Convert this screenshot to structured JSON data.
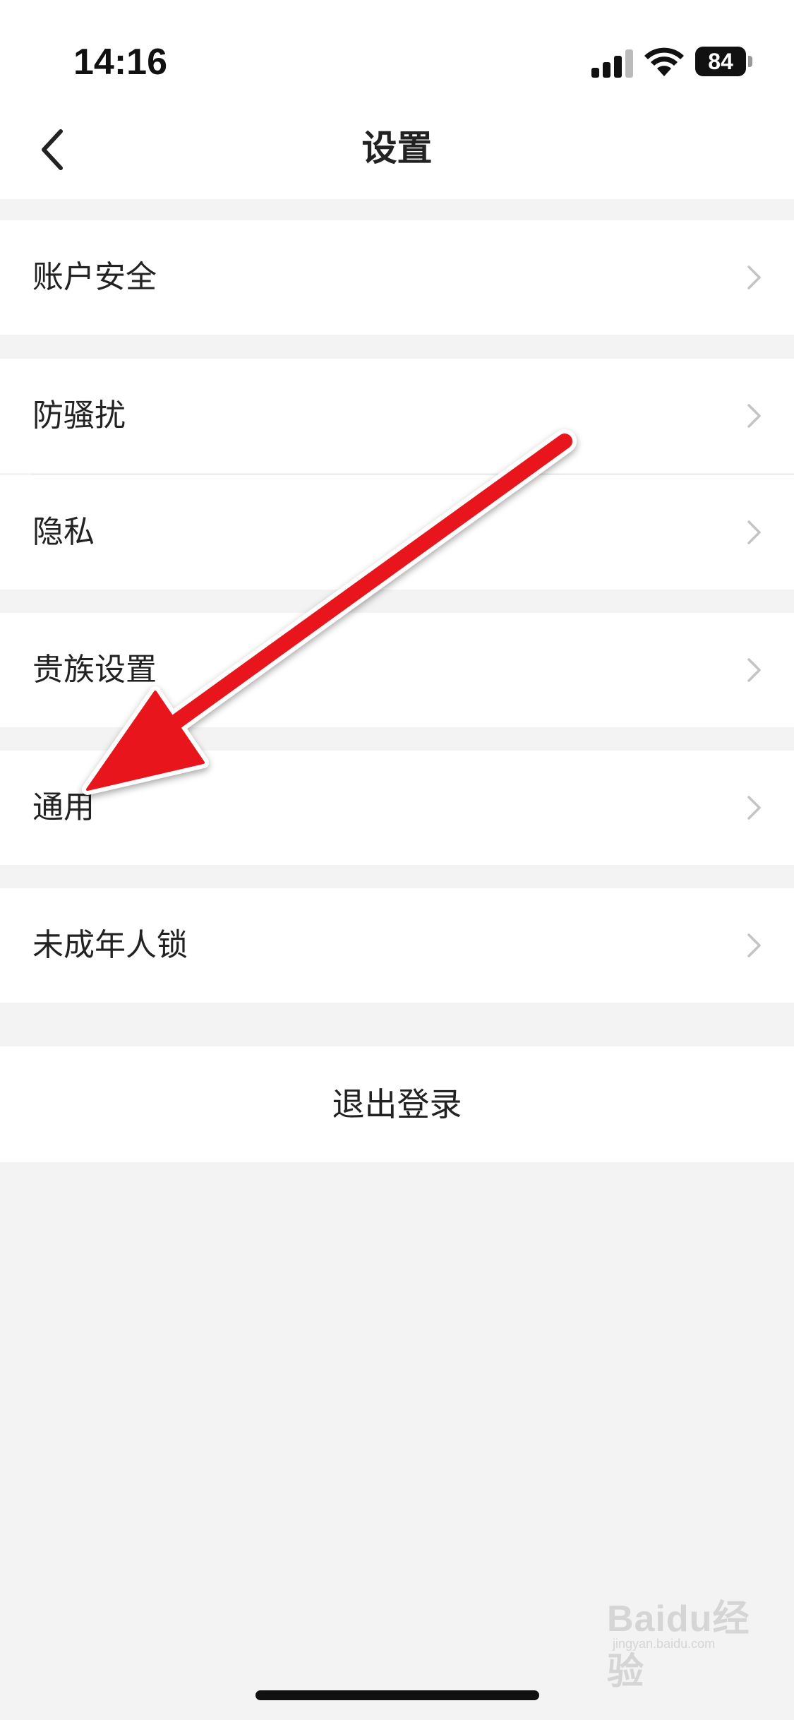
{
  "status_bar": {
    "time": "14:16",
    "battery": "84"
  },
  "nav": {
    "title": "设置",
    "back_icon": "chevron-left-icon"
  },
  "settings": {
    "items": [
      {
        "label": "账户安全"
      },
      {
        "label": "防骚扰"
      },
      {
        "label": "隐私"
      },
      {
        "label": "贵族设置"
      },
      {
        "label": "通用"
      },
      {
        "label": "未成年人锁"
      }
    ],
    "chevron_icon": "chevron-right-icon"
  },
  "logout": {
    "label": "退出登录"
  },
  "watermark": {
    "text": "Baidu经验",
    "sub": "jingyan.baidu.com"
  },
  "annotation": {
    "color": "#e8141a"
  }
}
